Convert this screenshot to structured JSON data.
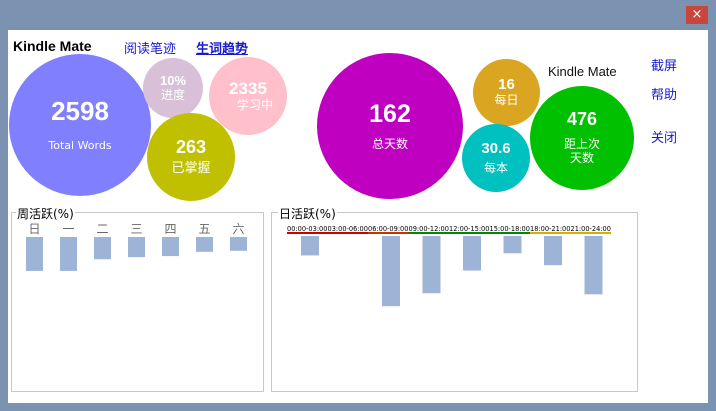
{
  "window": {
    "close_label": "×"
  },
  "header": {
    "brand": "Kindle Mate",
    "tabs": [
      {
        "label": "阅读笔迹"
      },
      {
        "label": "生词趋势"
      }
    ]
  },
  "side_menu": {
    "screenshot": "截屏",
    "help": "帮助",
    "close": "关闭"
  },
  "bubbles": {
    "total_words": {
      "value": "2598",
      "label": "Total Words",
      "color": "#8080ff"
    },
    "progress": {
      "value": "10%",
      "label": "进度",
      "color": "#d8c0d8"
    },
    "learning": {
      "value": "2335",
      "label": "学习中",
      "color": "#ffc0cb"
    },
    "mastered": {
      "value": "263",
      "label": "已掌握",
      "color": "#c0c000"
    },
    "total_days": {
      "value": "162",
      "label": "总天数",
      "color": "#c000c0"
    },
    "daily": {
      "value": "16",
      "label": "每日",
      "color": "#daa520"
    },
    "per_book": {
      "value": "30.6",
      "label": "每本",
      "color": "#00c0c0"
    },
    "since_last": {
      "value": "476",
      "label": "距上次天数",
      "label_line1": "距上次",
      "label_line2": "天数",
      "color": "#00c000"
    },
    "brand_label": "Kindle Mate"
  },
  "chart_data": [
    {
      "type": "bar",
      "title": "周活跃(%)",
      "categories": [
        "日",
        "一",
        "二",
        "三",
        "四",
        "五",
        "六"
      ],
      "values": [
        32,
        32,
        21,
        19,
        18,
        14,
        13
      ],
      "bar_color": "#9db4d6",
      "baseline": "top"
    },
    {
      "type": "bar",
      "title": "日活跃(%)",
      "categories": [
        "00:00-03:00",
        "03:00-06:00",
        "06:00-09:00",
        "09:00-12:00",
        "12:00-15:00",
        "15:00-18:00",
        "18:00-21:00",
        "21:00-24:00"
      ],
      "values": [
        18,
        0,
        65,
        53,
        32,
        16,
        27,
        54
      ],
      "bar_color": "#9db4d6",
      "baseline": "top",
      "header_line_colors": [
        "#cc0000",
        "#cc0000",
        "#cc3300",
        "#008800",
        "#008800",
        "#008800",
        "#d4b000",
        "#d4b000"
      ]
    }
  ]
}
